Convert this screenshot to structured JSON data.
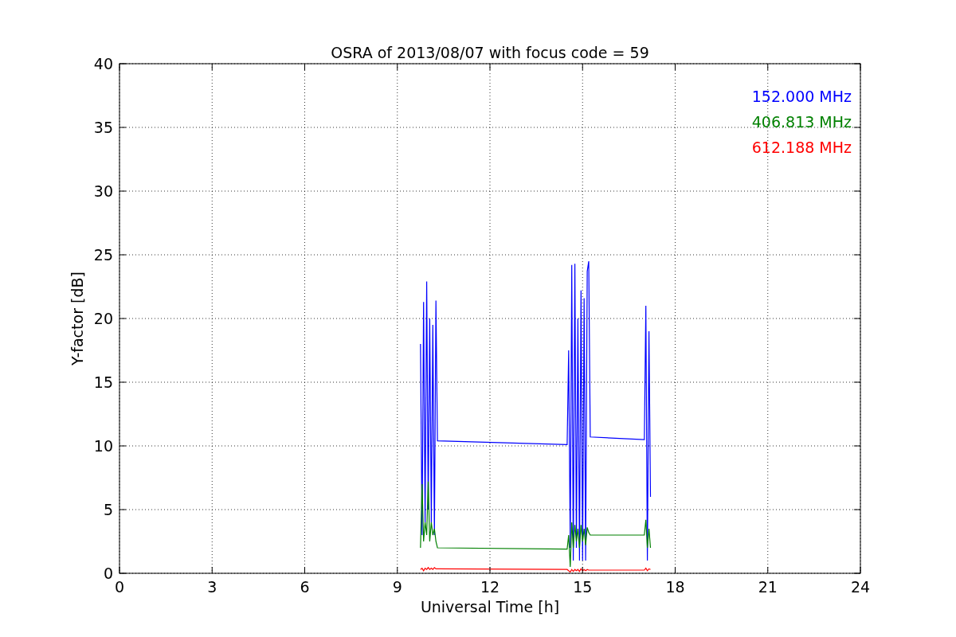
{
  "chart_data": {
    "type": "line",
    "title": "OSRA of 2013/08/07 with focus code = 59",
    "xlabel": "Universal Time [h]",
    "ylabel": "Y-factor [dB]",
    "x": [
      9.75,
      9.8,
      9.85,
      9.9,
      9.95,
      10.0,
      10.05,
      10.1,
      10.15,
      10.2,
      10.25,
      10.3,
      14.5,
      14.55,
      14.6,
      14.65,
      14.7,
      14.75,
      14.8,
      14.85,
      14.9,
      14.95,
      15.0,
      15.05,
      15.1,
      15.15,
      15.2,
      15.25,
      17.0,
      17.05,
      17.1,
      17.15,
      17.2
    ],
    "series": [
      {
        "name": "152.000 MHz",
        "color": "#0000ff",
        "values": [
          18,
          3,
          21.3,
          4,
          22.9,
          5,
          20,
          4,
          19.5,
          3,
          21.4,
          10.4,
          10.1,
          17.5,
          2,
          24.2,
          1,
          24.3,
          2,
          20,
          1,
          22.2,
          1,
          21.6,
          1,
          23.7,
          24.5,
          10.7,
          10.5,
          21,
          1,
          19,
          6
        ]
      },
      {
        "name": "406.813 MHz",
        "color": "#008000",
        "values": [
          2,
          7,
          2.5,
          4,
          3,
          7.2,
          2.5,
          4,
          3,
          3.5,
          2.5,
          2.0,
          1.9,
          3,
          0.5,
          4,
          2,
          3.8,
          2.5,
          3.5,
          2,
          3.8,
          2.5,
          3.5,
          2.2,
          3.6,
          3.2,
          3.0,
          3.0,
          4.2,
          2,
          3.5,
          2
        ]
      },
      {
        "name": "612.188 MHz",
        "color": "#ff0000",
        "values": [
          0.3,
          0.4,
          0.2,
          0.4,
          0.3,
          0.45,
          0.3,
          0.4,
          0.3,
          0.45,
          0.35,
          0.35,
          0.3,
          0.2,
          0.1,
          0.3,
          0.15,
          0.3,
          0.2,
          0.3,
          0.15,
          0.35,
          0.2,
          0.3,
          0.2,
          0.3,
          0.25,
          0.25,
          0.25,
          0.4,
          0.2,
          0.35,
          0.3
        ]
      }
    ],
    "xlim": [
      0,
      24
    ],
    "ylim": [
      0,
      40
    ],
    "xticks": [
      0,
      3,
      6,
      9,
      12,
      15,
      18,
      21,
      24
    ],
    "yticks": [
      0,
      5,
      10,
      15,
      20,
      25,
      30,
      35,
      40
    ],
    "grid": true
  }
}
